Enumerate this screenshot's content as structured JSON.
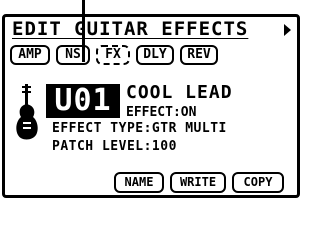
{
  "header": {
    "title": "EDIT GUITAR EFFECTS",
    "next_icon": "arrow-right-icon"
  },
  "tabs": [
    {
      "label": "AMP",
      "selected": false
    },
    {
      "label": "NS",
      "selected": false
    },
    {
      "label": "FX",
      "selected": true
    },
    {
      "label": "DLY",
      "selected": false
    },
    {
      "label": "REV",
      "selected": false
    }
  ],
  "patch": {
    "id": "U01",
    "name": "COOL LEAD",
    "effect_state": "EFFECT:ON",
    "icon": "guitar-icon"
  },
  "params": {
    "effect_type": "EFFECT TYPE:GTR MULTI",
    "patch_level": "PATCH LEVEL:100"
  },
  "buttons": {
    "name": "NAME",
    "write": "WRITE",
    "copy": "COPY"
  }
}
